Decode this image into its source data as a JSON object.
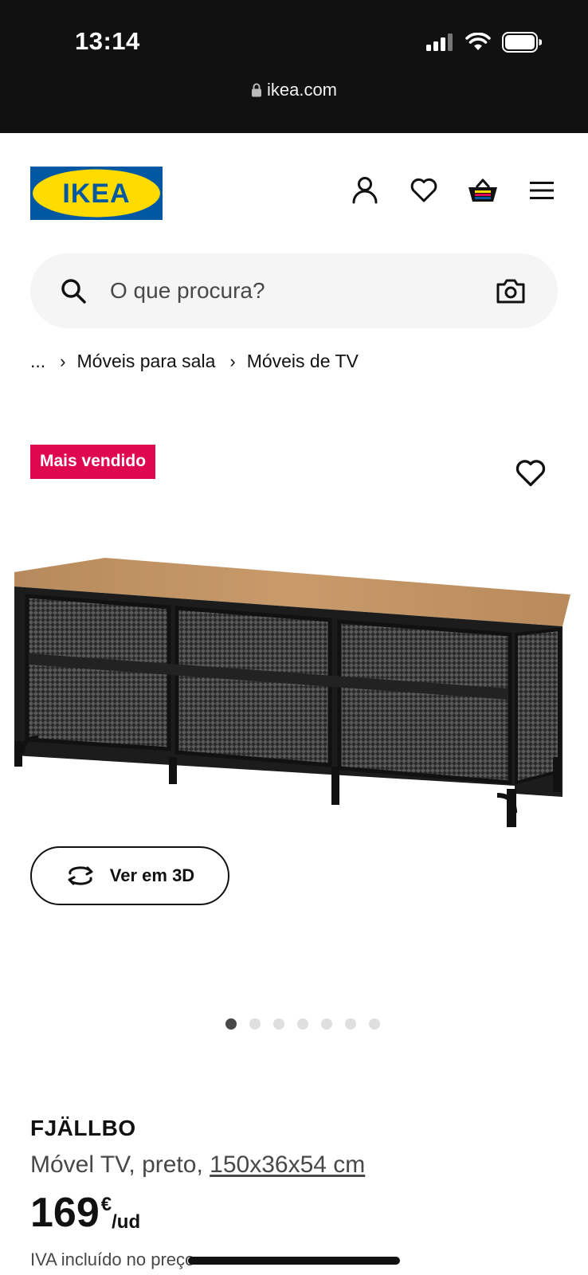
{
  "status_bar": {
    "time": "13:14",
    "url": "ikea.com",
    "icons": [
      "signal-icon",
      "wifi-icon",
      "battery-icon",
      "lock-icon"
    ]
  },
  "header": {
    "logo_text": "IKEA",
    "icons": [
      "user-icon",
      "heart-icon",
      "basket-icon",
      "menu-icon"
    ]
  },
  "search": {
    "placeholder": "O que procura?",
    "value": ""
  },
  "breadcrumb": {
    "items": [
      "...",
      "Móveis para sala",
      "Móveis de TV"
    ]
  },
  "product": {
    "badge": "Mais vendido",
    "view_3d_label": "Ver em 3D",
    "carousel": {
      "total": 7,
      "active": 0
    },
    "name": "FJÄLLBO",
    "description": "Móvel TV, preto,",
    "dimensions": "150x36x54 cm",
    "price": "169",
    "currency": "€",
    "unit": "/ud",
    "vat_note": "IVA incluído no preço"
  },
  "colors": {
    "ikea_blue": "#0058a3",
    "ikea_yellow": "#ffdb00",
    "badge_red": "#e00751"
  }
}
